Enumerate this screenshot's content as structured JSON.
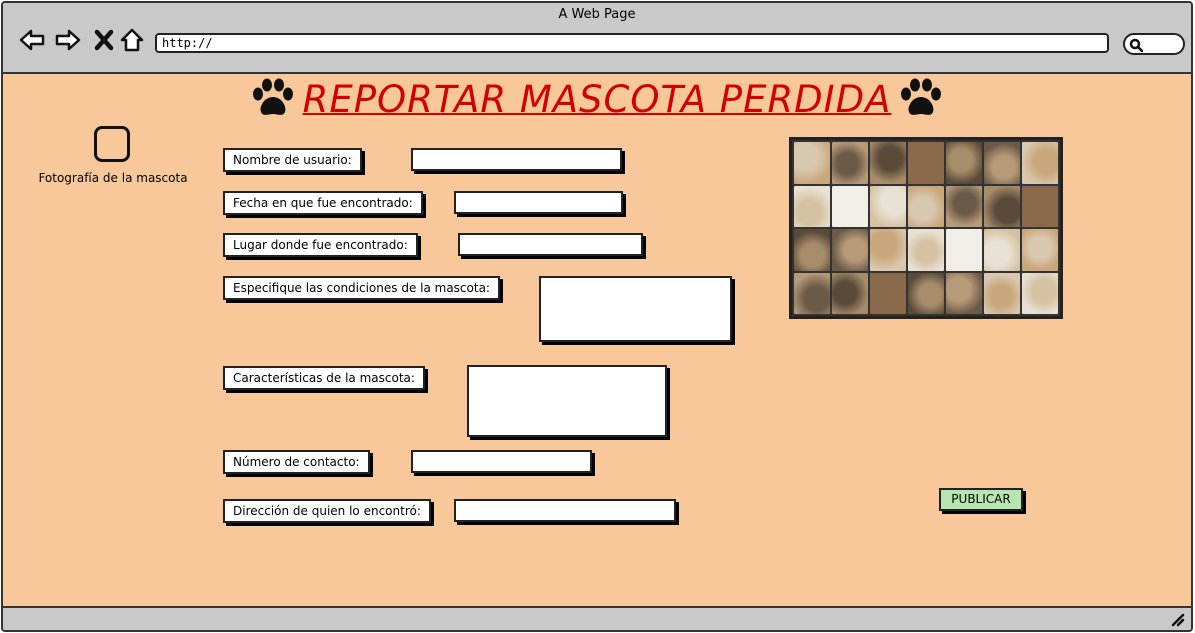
{
  "window": {
    "title": "A Web Page"
  },
  "browser": {
    "url": "http://",
    "buttons": [
      "back-icon",
      "forward-icon",
      "close-icon",
      "home-icon"
    ],
    "search_icon": "search-icon"
  },
  "header": {
    "title": "REPORTAR MASCOTA PERDIDA",
    "icon": "paw-icon",
    "title_color": "#d40000"
  },
  "photo": {
    "label": "Fotografía de la mascota"
  },
  "form": {
    "fields": [
      {
        "label": "Nombre de usuario:"
      },
      {
        "label": "Fecha en que fue encontrado:"
      },
      {
        "label": "Lugar donde fue encontrado:"
      },
      {
        "label": "Especifique las condiciones de la mascota:"
      },
      {
        "label": "Características de la mascota:"
      },
      {
        "label": "Número de contacto:"
      },
      {
        "label": "Dirección de quien lo encontró:"
      }
    ]
  },
  "publish": {
    "label": "PUBLICAR",
    "color": "#b8e6b0"
  },
  "colors": {
    "background": "#f8c89a",
    "chrome": "#c9c9c9"
  }
}
